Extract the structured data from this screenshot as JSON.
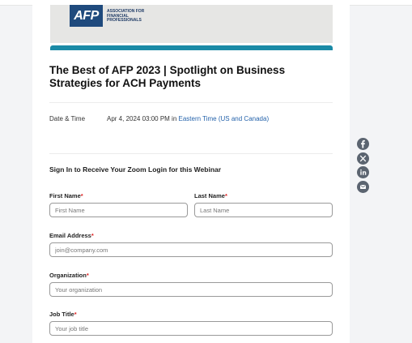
{
  "banner": {
    "logo_mark": "AFP",
    "logo_text": "ASSOCIATION FOR\nFINANCIAL\nPROFESSIONALS"
  },
  "event": {
    "title": "The Best of AFP 2023 | Spotlight on Business Strategies for ACH Payments",
    "date_time_label": "Date & Time",
    "date_time_value": "Apr 4, 2024 03:00 PM in ",
    "timezone_link": "Eastern Time (US and Canada)"
  },
  "form": {
    "heading": "Sign In to Receive Your Zoom Login for this Webinar",
    "required_mark": "*",
    "fields": {
      "first_name": {
        "label": "First Name",
        "placeholder": "First Name"
      },
      "last_name": {
        "label": "Last Name",
        "placeholder": "Last Name"
      },
      "email": {
        "label": "Email Address",
        "placeholder": "join@company.com"
      },
      "organization": {
        "label": "Organization",
        "placeholder": "Your organization"
      },
      "job_title": {
        "label": "Job Title",
        "placeholder": "Your job title"
      }
    }
  },
  "share": {
    "icons": [
      "facebook-icon",
      "x-icon",
      "linkedin-icon",
      "email-icon"
    ]
  },
  "colors": {
    "accent_bar": "#1a8aa6",
    "link": "#2563ab",
    "required": "#dd2222",
    "logo_mark": "#1f4a7d",
    "share_icon_bg": "#5b6470"
  }
}
